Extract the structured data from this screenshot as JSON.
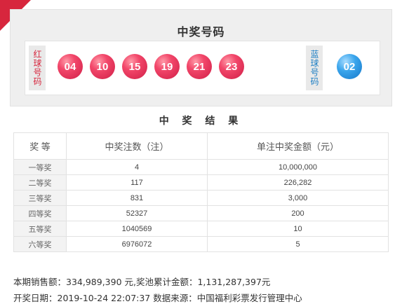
{
  "draw": {
    "title": "中奖号码",
    "red_label": "红球号码",
    "blue_label": "蓝球号码",
    "red_balls": [
      "04",
      "10",
      "15",
      "19",
      "21",
      "23"
    ],
    "blue_ball": "02"
  },
  "results": {
    "title": "中 奖 结 果",
    "headers": [
      "奖 等",
      "中奖注数（注）",
      "单注中奖金额（元）"
    ],
    "rows": [
      {
        "level": "一等奖",
        "count": "4",
        "amount": "10,000,000"
      },
      {
        "level": "二等奖",
        "count": "117",
        "amount": "226,282"
      },
      {
        "level": "三等奖",
        "count": "831",
        "amount": "3,000"
      },
      {
        "level": "四等奖",
        "count": "52327",
        "amount": "200"
      },
      {
        "level": "五等奖",
        "count": "1040569",
        "amount": "10"
      },
      {
        "level": "六等奖",
        "count": "6976072",
        "amount": "5"
      }
    ]
  },
  "footer": {
    "line1": "本期销售额：334,989,390 元,奖池累计金额：1,131,287,397元",
    "line2": "开奖日期：2019-10-24 22:07:37 数据来源：中国福利彩票发行管理中心"
  },
  "colors": {
    "ribbon": "#d7263d",
    "red_ball": "#e32a50",
    "blue_ball": "#2a8fdb"
  }
}
